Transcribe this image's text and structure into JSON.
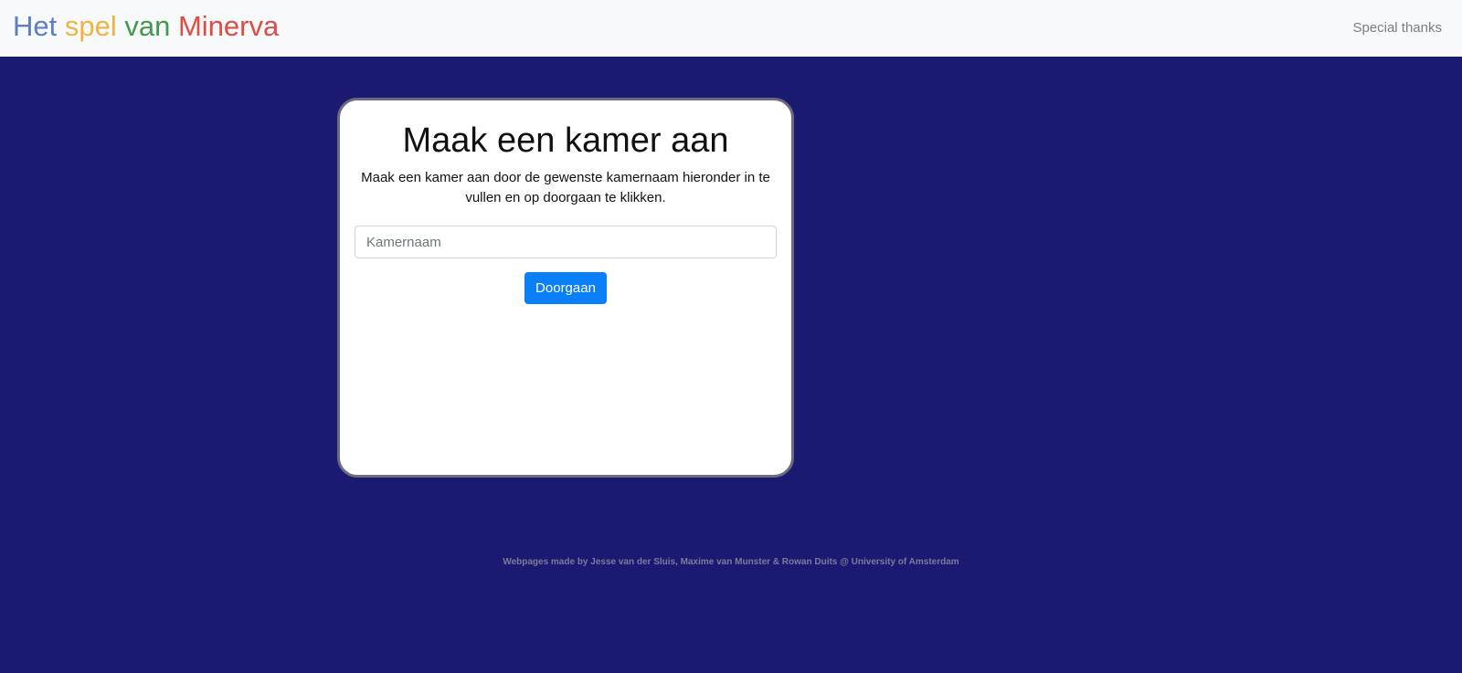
{
  "navbar": {
    "brand": {
      "word1": "Het",
      "word2": "spel",
      "word3": "van",
      "word4": "Minerva"
    },
    "link_special_thanks": "Special thanks"
  },
  "card": {
    "title": "Maak een kamer aan",
    "text": "Maak een kamer aan door de gewenste kamernaam hieronder in te vullen en op doorgaan te klikken.",
    "input_placeholder": "Kamernaam",
    "input_value": "",
    "button_label": "Doorgaan"
  },
  "footer": {
    "text": "Webpages made by Jesse van der Sluis, Maxime van Munster & Rowan Duits @ University of Amsterdam"
  },
  "colors": {
    "background": "#1a1a72",
    "navbar_background": "#f8f9fa",
    "brand_word1": "#5b7fc0",
    "brand_word2": "#f0b342",
    "brand_word3": "#3f9a4b",
    "brand_word4": "#de4c43",
    "button": "#0b7ff7"
  }
}
